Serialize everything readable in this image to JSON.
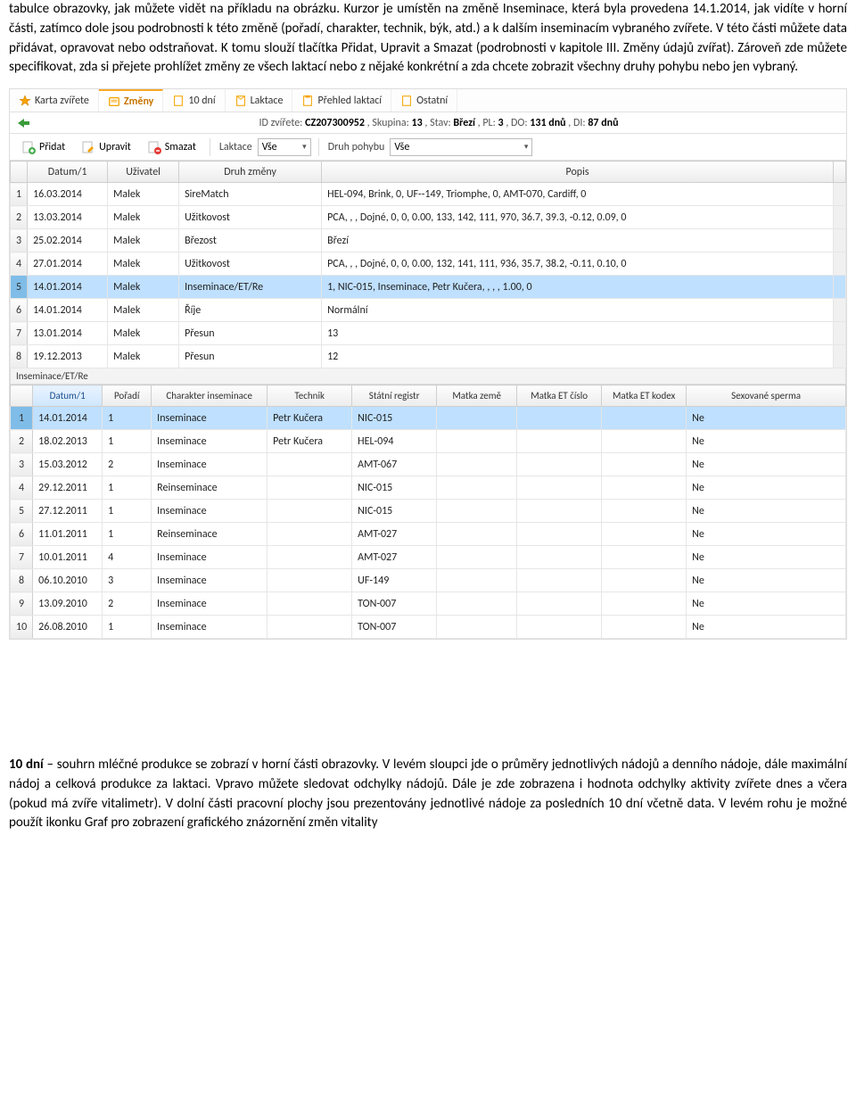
{
  "doc": {
    "para1": "tabulce obrazovky, jak můžete vidět na příkladu na obrázku. Kurzor je umístěn na změně Inseminace, která byla provedena 14.1.2014, jak vidíte v horní části, zatímco dole jsou podrobnosti k této změně (pořadí, charakter, technik, býk, atd.) a k dalším inseminacím vybraného zvířete. V této části můžete data přidávat, opravovat nebo odstraňovat. K tomu slouží tlačítka Přidat, Upravit a Smazat (podrobnosti v kapitole III. Změny údajů zvířat). Zároveň zde můžete specifikovat, zda si přejete prohlížet změny ze všech laktací nebo z nějaké konkrétní a zda chcete zobrazit všechny druhy pohybu nebo jen vybraný.",
    "para2_lead": "10 dní",
    "para2": " – souhrn mléčné produkce se zobrazí v horní části obrazovky. V levém sloupci jde o průměry jednotlivých nádojů a denního nádoje, dále maximální nádoj a celková produkce za laktaci. Vpravo můžete sledovat odchylky nádojů. Dále je zde zobrazena i hodnota odchylky aktivity zvířete dnes a včera (pokud má zvíře vitalimetr). V dolní části pracovní plochy jsou prezentovány jednotlivé nádoje za posledních 10 dní včetně data. V levém rohu je možné použít ikonku Graf pro zobrazení grafického znázornění změn vitality"
  },
  "tabs": {
    "t1": "Karta zvířete",
    "t2": "Změny",
    "t3": "10 dní",
    "t4": "Laktace",
    "t5": "Přehled laktací",
    "t6": "Ostatní"
  },
  "info": {
    "prefix": "ID zvířete: ",
    "id": "CZ207300952",
    "skupina_l": ", Skupina: ",
    "skupina": "13",
    "stav_l": ", Stav: ",
    "stav": "Březí",
    "pl_l": ", PL: ",
    "pl": "3",
    "do_l": ", DO: ",
    "do": "131 dnů",
    "di_l": ", DI: ",
    "di": "87 dnů"
  },
  "toolbar": {
    "pridat": "Přidat",
    "upravit": "Upravit",
    "smazat": "Smazat",
    "laktace_l": "Laktace",
    "laktace_v": "Vše",
    "druh_l": "Druh pohybu",
    "druh_v": "Vše"
  },
  "cols1": {
    "c1": "Datum/1",
    "c2": "Uživatel",
    "c3": "Druh změny",
    "c4": "Popis"
  },
  "rows1": [
    {
      "n": "1",
      "d": "16.03.2014",
      "u": "Malek",
      "t": "SireMatch",
      "p": "HEL-094, Brink, 0, UF--149, Triomphe, 0, AMT-070, Cardiff, 0"
    },
    {
      "n": "2",
      "d": "13.03.2014",
      "u": "Malek",
      "t": "Užitkovost",
      "p": "PCA, , , Dojné, 0, 0, 0.00, 133, 142, 111, 970, 36.7, 39.3, -0.12, 0.09, 0"
    },
    {
      "n": "3",
      "d": "25.02.2014",
      "u": "Malek",
      "t": "Březost",
      "p": "Březí"
    },
    {
      "n": "4",
      "d": "27.01.2014",
      "u": "Malek",
      "t": "Užitkovost",
      "p": "PCA, , , Dojné, 0, 0, 0.00, 132, 141, 111, 936, 35.7, 38.2, -0.11, 0.10, 0"
    },
    {
      "n": "5",
      "d": "14.01.2014",
      "u": "Malek",
      "t": "Inseminace/ET/Re",
      "p": "1, NIC-015, Inseminace, Petr Kučera, , , , 1.00, 0"
    },
    {
      "n": "6",
      "d": "14.01.2014",
      "u": "Malek",
      "t": "Říje",
      "p": "Normální"
    },
    {
      "n": "7",
      "d": "13.01.2014",
      "u": "Malek",
      "t": "Přesun",
      "p": "13"
    },
    {
      "n": "8",
      "d": "19.12.2013",
      "u": "Malek",
      "t": "Přesun",
      "p": "12"
    }
  ],
  "section2_title": "Inseminace/ET/Re",
  "cols2": {
    "c1": "Datum/1",
    "c2": "Pořadí",
    "c3": "Charakter inseminace",
    "c4": "Technik",
    "c5": "Státní registr",
    "c6": "Matka země",
    "c7": "Matka ET číslo",
    "c8": "Matka ET kodex",
    "c9": "Sexované sperma"
  },
  "rows2": [
    {
      "n": "1",
      "d": "14.01.2014",
      "p": "1",
      "c": "Inseminace",
      "t": "Petr Kučera",
      "s": "NIC-015",
      "mz": "",
      "mc": "",
      "mk": "",
      "sx": "Ne"
    },
    {
      "n": "2",
      "d": "18.02.2013",
      "p": "1",
      "c": "Inseminace",
      "t": "Petr Kučera",
      "s": "HEL-094",
      "mz": "",
      "mc": "",
      "mk": "",
      "sx": "Ne"
    },
    {
      "n": "3",
      "d": "15.03.2012",
      "p": "2",
      "c": "Inseminace",
      "t": "",
      "s": "AMT-067",
      "mz": "",
      "mc": "",
      "mk": "",
      "sx": "Ne"
    },
    {
      "n": "4",
      "d": "29.12.2011",
      "p": "1",
      "c": "Reinseminace",
      "t": "",
      "s": "NIC-015",
      "mz": "",
      "mc": "",
      "mk": "",
      "sx": "Ne"
    },
    {
      "n": "5",
      "d": "27.12.2011",
      "p": "1",
      "c": "Inseminace",
      "t": "",
      "s": "NIC-015",
      "mz": "",
      "mc": "",
      "mk": "",
      "sx": "Ne"
    },
    {
      "n": "6",
      "d": "11.01.2011",
      "p": "1",
      "c": "Reinseminace",
      "t": "",
      "s": "AMT-027",
      "mz": "",
      "mc": "",
      "mk": "",
      "sx": "Ne"
    },
    {
      "n": "7",
      "d": "10.01.2011",
      "p": "4",
      "c": "Inseminace",
      "t": "",
      "s": "AMT-027",
      "mz": "",
      "mc": "",
      "mk": "",
      "sx": "Ne"
    },
    {
      "n": "8",
      "d": "06.10.2010",
      "p": "3",
      "c": "Inseminace",
      "t": "",
      "s": "UF-149",
      "mz": "",
      "mc": "",
      "mk": "",
      "sx": "Ne"
    },
    {
      "n": "9",
      "d": "13.09.2010",
      "p": "2",
      "c": "Inseminace",
      "t": "",
      "s": "TON-007",
      "mz": "",
      "mc": "",
      "mk": "",
      "sx": "Ne"
    },
    {
      "n": "10",
      "d": "26.08.2010",
      "p": "1",
      "c": "Inseminace",
      "t": "",
      "s": "TON-007",
      "mz": "",
      "mc": "",
      "mk": "",
      "sx": "Ne"
    }
  ]
}
